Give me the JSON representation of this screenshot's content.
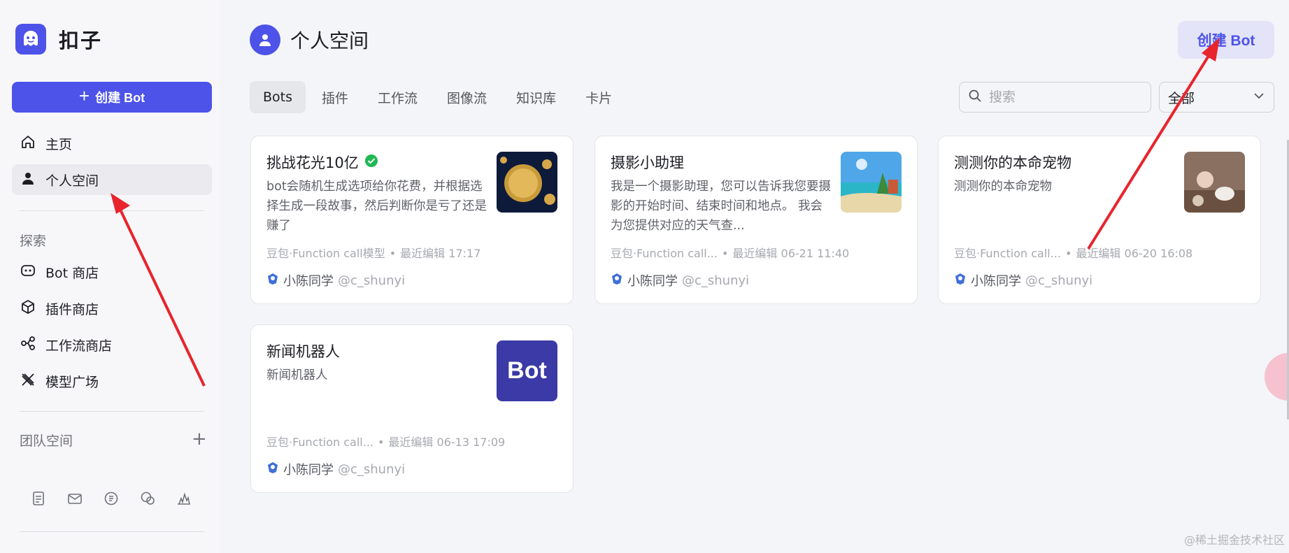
{
  "brand": {
    "name": "扣子"
  },
  "sidebar": {
    "create_label": "创建 Bot",
    "nav": [
      {
        "label": "主页",
        "icon": "home-icon"
      },
      {
        "label": "个人空间",
        "icon": "user-icon"
      }
    ],
    "explore_label": "探索",
    "explore": [
      {
        "label": "Bot 商店",
        "icon": "bot-icon"
      },
      {
        "label": "插件商店",
        "icon": "cube-icon"
      },
      {
        "label": "工作流商店",
        "icon": "workflow-icon"
      },
      {
        "label": "模型广场",
        "icon": "model-icon"
      }
    ],
    "team_label": "团队空间",
    "team_add": "+",
    "bottom_icons": [
      "document-icon",
      "mail-icon",
      "chat-icon",
      "wechat-icon",
      "chart-icon"
    ]
  },
  "header": {
    "title": "个人空间",
    "create_label": "创建 Bot"
  },
  "tabs": [
    {
      "label": "Bots",
      "active": true
    },
    {
      "label": "插件"
    },
    {
      "label": "工作流"
    },
    {
      "label": "图像流"
    },
    {
      "label": "知识库"
    },
    {
      "label": "卡片"
    }
  ],
  "search": {
    "placeholder": "搜索"
  },
  "filter": {
    "value": "全部"
  },
  "cards": [
    {
      "title": "挑战花光10亿",
      "verified": true,
      "desc": "bot会随机生成选项给你花费，并根据选择生成一段故事，然后判断你是亏了还是赚了",
      "model": "豆包·Function call模型",
      "edited": "最近编辑 17:17",
      "author": "小陈同学",
      "handle": "@c_shunyi"
    },
    {
      "title": "摄影小助理",
      "desc": "我是一个摄影助理，您可以告诉我您要摄影的开始时间、结束时间和地点。 我会为您提供对应的天气查...",
      "model": "豆包·Function call...",
      "edited": "最近编辑 06-21 11:40",
      "author": "小陈同学",
      "handle": "@c_shunyi"
    },
    {
      "title": "测测你的本命宠物",
      "desc": "测测你的本命宠物",
      "model": "豆包·Function call...",
      "edited": "最近编辑 06-20 16:08",
      "author": "小陈同学",
      "handle": "@c_shunyi"
    },
    {
      "title": "新闻机器人",
      "desc": "新闻机器人",
      "thumb_text": "Bot",
      "model": "豆包·Function call...",
      "edited": "最近编辑 06-13 17:09",
      "author": "小陈同学",
      "handle": "@c_shunyi"
    }
  ],
  "dot": "•",
  "watermark": "@稀土掘金技术社区",
  "colors": {
    "accent": "#4d53e8",
    "annotation_arrow": "#e8242c",
    "verified": "#1fb854"
  }
}
